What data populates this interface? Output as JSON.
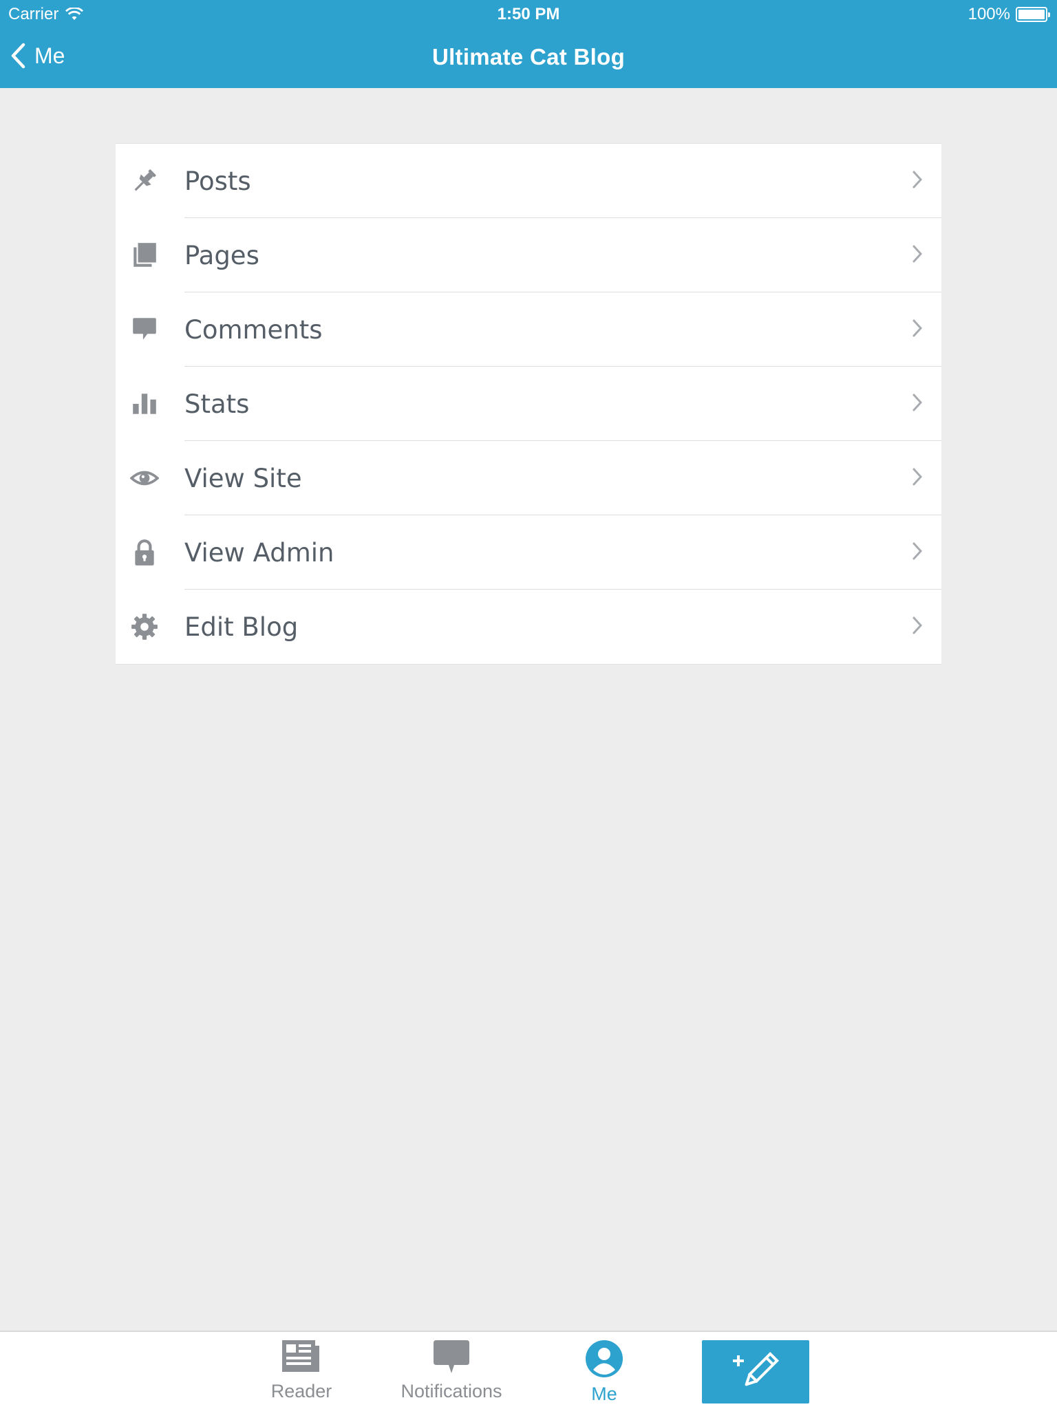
{
  "status_bar": {
    "carrier": "Carrier",
    "time": "1:50 PM",
    "battery": "100%"
  },
  "navbar": {
    "back_label": "Me",
    "title": "Ultimate Cat Blog"
  },
  "menu": {
    "items": [
      {
        "label": "Posts",
        "icon": "pin-icon"
      },
      {
        "label": "Pages",
        "icon": "pages-icon"
      },
      {
        "label": "Comments",
        "icon": "comment-icon"
      },
      {
        "label": "Stats",
        "icon": "stats-icon"
      },
      {
        "label": "View Site",
        "icon": "eye-icon"
      },
      {
        "label": "View Admin",
        "icon": "lock-icon"
      },
      {
        "label": "Edit Blog",
        "icon": "gear-icon"
      }
    ]
  },
  "tabbar": {
    "reader": "Reader",
    "notifications": "Notifications",
    "me": "Me",
    "active": "Me"
  },
  "colors": {
    "accent": "#2ea2cf",
    "icon": "#8c8f94",
    "text": "#555d66",
    "background": "#ededed"
  }
}
